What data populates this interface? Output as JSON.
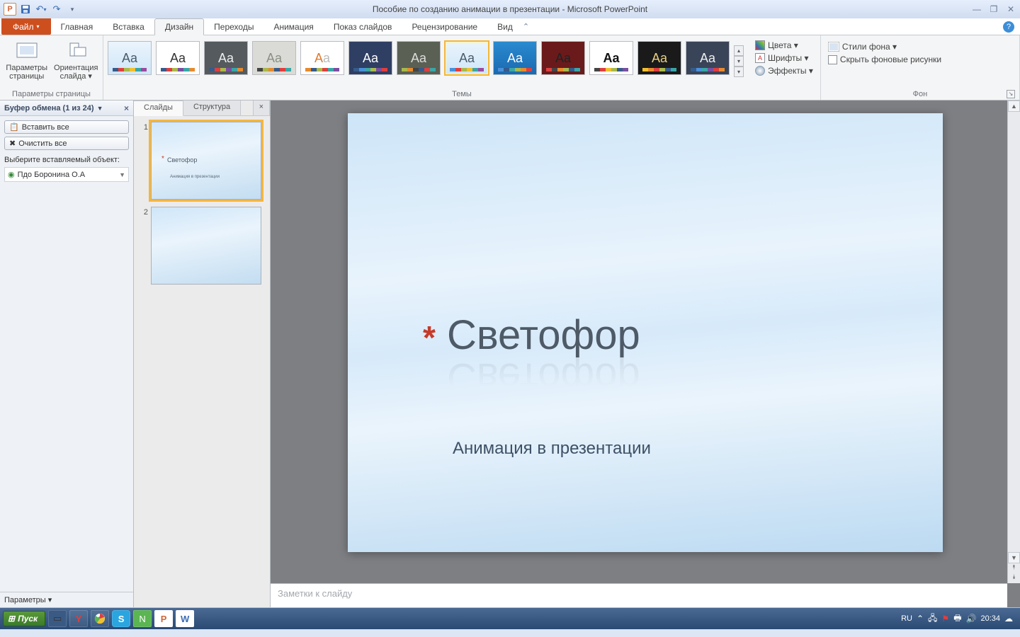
{
  "titlebar": {
    "doc_title": "Пособие по созданию анимации в презентации  -  Microsoft PowerPoint"
  },
  "tabs": {
    "file": "Файл",
    "items": [
      "Главная",
      "Вставка",
      "Дизайн",
      "Переходы",
      "Анимация",
      "Показ слайдов",
      "Рецензирование",
      "Вид"
    ],
    "active_index": 2
  },
  "ribbon": {
    "page_setup": {
      "params": "Параметры\nстраницы",
      "orientation": "Ориентация\nслайда ▾",
      "group_label": "Параметры страницы"
    },
    "themes_label": "Темы",
    "colors": "Цвета ▾",
    "fonts": "Шрифты ▾",
    "effects": "Эффекты ▾",
    "bg_styles": "Стили фона ▾",
    "hide_bg": "Скрыть фоновые рисунки",
    "bg_label": "Фон"
  },
  "clip": {
    "header": "Буфер обмена (1 из 24)",
    "paste_all": "Вставить все",
    "clear_all": "Очистить все",
    "pick_label": "Выберите вставляемый объект:",
    "item": "Пдо Боронина О.А",
    "options": "Параметры ▾"
  },
  "slides_panel": {
    "tab_slides": "Слайды",
    "tab_outline": "Структура",
    "thumb_title": "Светофор",
    "thumb_sub": "Анимация в презентации"
  },
  "slide": {
    "title": "Светофор",
    "subtitle": "Анимация в презентации"
  },
  "notes_placeholder": "Заметки к слайду",
  "taskbar": {
    "start": "Пуск",
    "lang": "RU",
    "clock": "20:34"
  }
}
